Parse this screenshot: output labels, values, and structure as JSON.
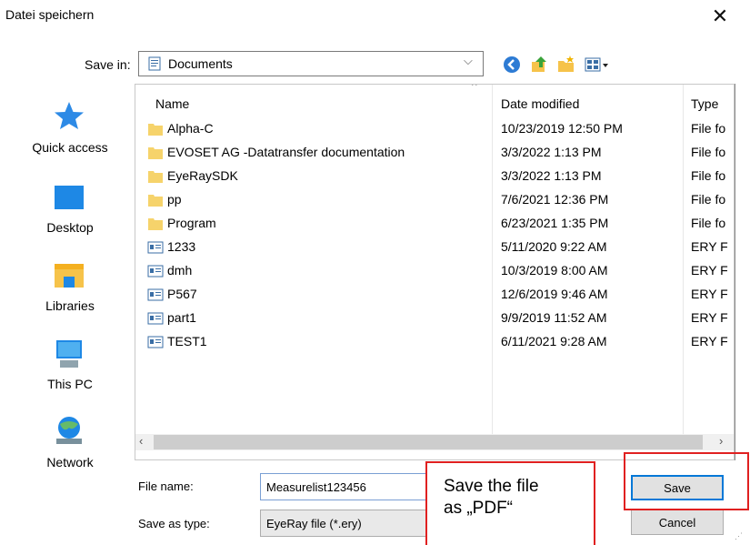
{
  "dialog": {
    "title": "Datei speichern",
    "close_glyph": "✕"
  },
  "save_in": {
    "label": "Save in:",
    "value": "Documents"
  },
  "places": [
    {
      "label": "Quick access",
      "icon": "star-icon"
    },
    {
      "label": "Desktop",
      "icon": "desktop-icon"
    },
    {
      "label": "Libraries",
      "icon": "libraries-icon"
    },
    {
      "label": "This PC",
      "icon": "this-pc-icon"
    },
    {
      "label": "Network",
      "icon": "network-icon"
    }
  ],
  "columns": {
    "name": "Name",
    "date": "Date modified",
    "type": "Type"
  },
  "files": [
    {
      "name": "Alpha-C",
      "date": "10/23/2019 12:50 PM",
      "type": "File fo",
      "kind": "folder"
    },
    {
      "name": "EVOSET AG -Datatransfer documentation",
      "date": "3/3/2022 1:13 PM",
      "type": "File fo",
      "kind": "folder"
    },
    {
      "name": "EyeRaySDK",
      "date": "3/3/2022 1:13 PM",
      "type": "File fo",
      "kind": "folder"
    },
    {
      "name": "pp",
      "date": "7/6/2021 12:36 PM",
      "type": "File fo",
      "kind": "folder"
    },
    {
      "name": "Program",
      "date": "6/23/2021 1:35 PM",
      "type": "File fo",
      "kind": "folder"
    },
    {
      "name": "1233",
      "date": "5/11/2020 9:22 AM",
      "type": "ERY F",
      "kind": "file"
    },
    {
      "name": "dmh",
      "date": "10/3/2019 8:00 AM",
      "type": "ERY F",
      "kind": "file"
    },
    {
      "name": "P567",
      "date": "12/6/2019 9:46 AM",
      "type": "ERY F",
      "kind": "file"
    },
    {
      "name": "part1",
      "date": "9/9/2019 11:52 AM",
      "type": "ERY F",
      "kind": "file"
    },
    {
      "name": "TEST1",
      "date": "6/11/2021 9:28 AM",
      "type": "ERY F",
      "kind": "file"
    }
  ],
  "file_name": {
    "label": "File name:",
    "value": "Measurelist123456"
  },
  "save_as_type": {
    "label": "Save as type:",
    "value": "EyeRay file (*.ery)"
  },
  "buttons": {
    "save": "Save",
    "cancel": "Cancel"
  },
  "annotation": {
    "line1": "Save the file",
    "line2": "as „PDF“",
    "color": "#e02020"
  },
  "colors": {
    "folder": "#f6d36b",
    "accent": "#0078d7"
  }
}
